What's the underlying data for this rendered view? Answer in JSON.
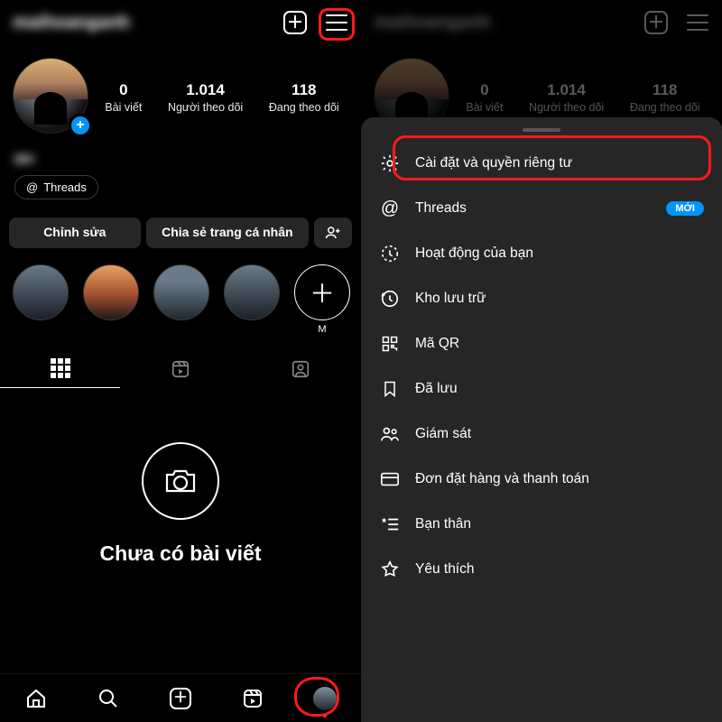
{
  "left": {
    "username": "maihoanganh",
    "avatar_plus": "+",
    "stats": [
      {
        "n": "0",
        "l": "Bài viết"
      },
      {
        "n": "1.014",
        "l": "Người theo dõi"
      },
      {
        "n": "118",
        "l": "Đang theo dõi"
      }
    ],
    "display_name": "MH",
    "threads_pill": "Threads",
    "buttons": {
      "edit": "Chỉnh sửa",
      "share": "Chia sẻ trang cá nhân"
    },
    "highlight_add_caption": "M",
    "tabs": [
      "grid",
      "reels",
      "tagged"
    ],
    "empty_title": "Chưa có bài viết"
  },
  "right": {
    "username": "maihoanganh",
    "stats": [
      {
        "n": "0",
        "l": "Bài viết"
      },
      {
        "n": "1.014",
        "l": "Người theo dõi"
      },
      {
        "n": "118",
        "l": "Đang theo dõi"
      }
    ],
    "menu": [
      {
        "icon": "gear",
        "label": "Cài đặt và quyền riêng tư"
      },
      {
        "icon": "threads",
        "label": "Threads",
        "badge": "MỚI"
      },
      {
        "icon": "activity",
        "label": "Hoạt động của bạn"
      },
      {
        "icon": "archive",
        "label": "Kho lưu trữ"
      },
      {
        "icon": "qr",
        "label": "Mã QR"
      },
      {
        "icon": "saved",
        "label": "Đã lưu"
      },
      {
        "icon": "supervise",
        "label": "Giám sát"
      },
      {
        "icon": "orders",
        "label": "Đơn đặt hàng và thanh toán"
      },
      {
        "icon": "close-fr",
        "label": "Bạn thân"
      },
      {
        "icon": "favorite",
        "label": "Yêu thích"
      }
    ]
  }
}
